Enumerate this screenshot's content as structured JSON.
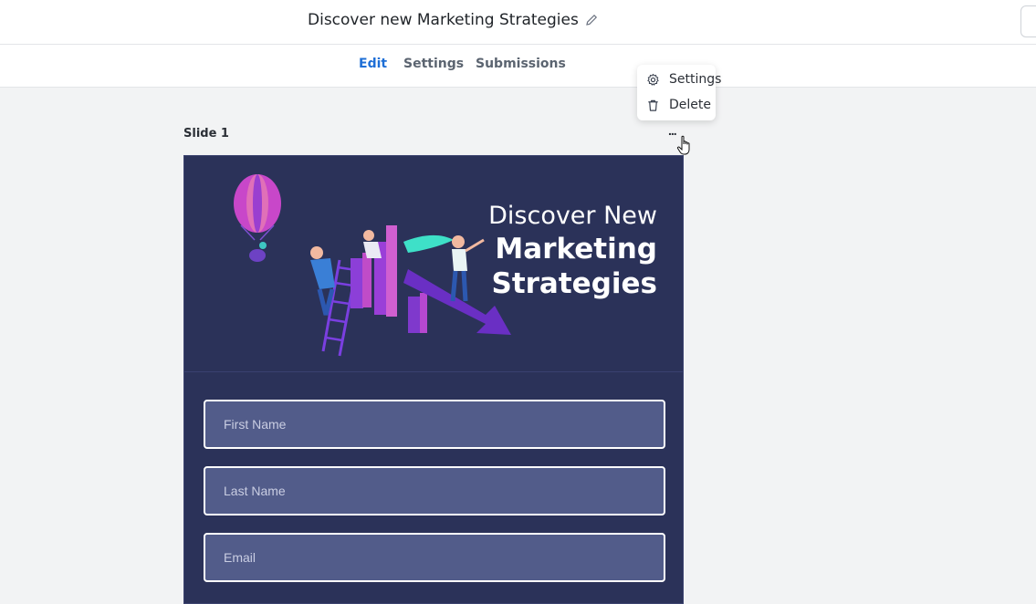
{
  "header": {
    "title": "Discover new Marketing Strategies"
  },
  "tabs": [
    {
      "label": "Edit"
    },
    {
      "label": "Settings"
    },
    {
      "label": "Submissions"
    }
  ],
  "context_menu": {
    "items": [
      {
        "label": "Settings",
        "icon": "gear-icon"
      },
      {
        "label": "Delete",
        "icon": "trash-icon"
      }
    ]
  },
  "slide": {
    "label": "Slide 1",
    "more_label": "...",
    "hero": {
      "line1": "Discover New",
      "line2": "Marketing",
      "line3": "Strategies"
    },
    "fields": [
      {
        "placeholder": "First Name"
      },
      {
        "placeholder": "Last Name"
      },
      {
        "placeholder": "Email"
      }
    ]
  },
  "colors": {
    "accent": "#1f6fd6",
    "slide_bg": "#2b3259",
    "field_bg": "#525c8a"
  }
}
